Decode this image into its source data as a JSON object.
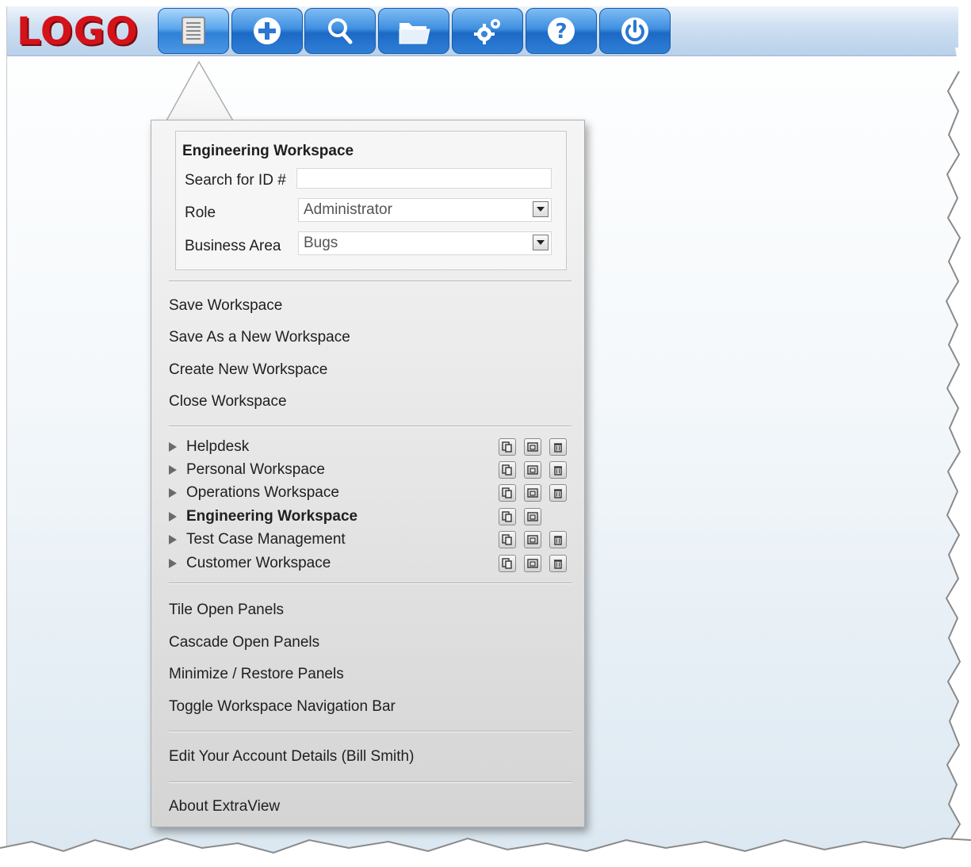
{
  "app": {
    "logo_text": "LOGO",
    "brand_color": "#d3121a"
  },
  "toolbar": {
    "buttons": [
      {
        "icon": "workspace-list-icon",
        "active": true
      },
      {
        "icon": "add-icon"
      },
      {
        "icon": "search-icon"
      },
      {
        "icon": "folder-icon"
      },
      {
        "icon": "settings-gears-icon"
      },
      {
        "icon": "help-icon"
      },
      {
        "icon": "power-icon"
      }
    ]
  },
  "workspace_panel": {
    "title": "Engineering Workspace",
    "search_label": "Search for ID #",
    "search_value": "",
    "role_label": "Role",
    "role_value": "Administrator",
    "business_area_label": "Business Area",
    "business_area_value": "Bugs"
  },
  "menu": {
    "actions": [
      "Save Workspace",
      "Save As a New Workspace",
      "Create New Workspace",
      "Close Workspace"
    ],
    "workspaces": [
      {
        "label": "Helpdesk",
        "current": false,
        "deletable": true
      },
      {
        "label": "Personal Workspace",
        "current": false,
        "deletable": true
      },
      {
        "label": "Operations Workspace",
        "current": false,
        "deletable": true
      },
      {
        "label": "Engineering Workspace",
        "current": true,
        "deletable": false
      },
      {
        "label": "Test Case Management",
        "current": false,
        "deletable": true
      },
      {
        "label": "Customer Workspace",
        "current": false,
        "deletable": true
      }
    ],
    "panel_actions": [
      "Tile Open Panels",
      "Cascade Open Panels",
      "Minimize / Restore Panels",
      "Toggle Workspace Navigation Bar"
    ],
    "account": "Edit Your Account Details (Bill Smith)",
    "about": "About ExtraView"
  }
}
